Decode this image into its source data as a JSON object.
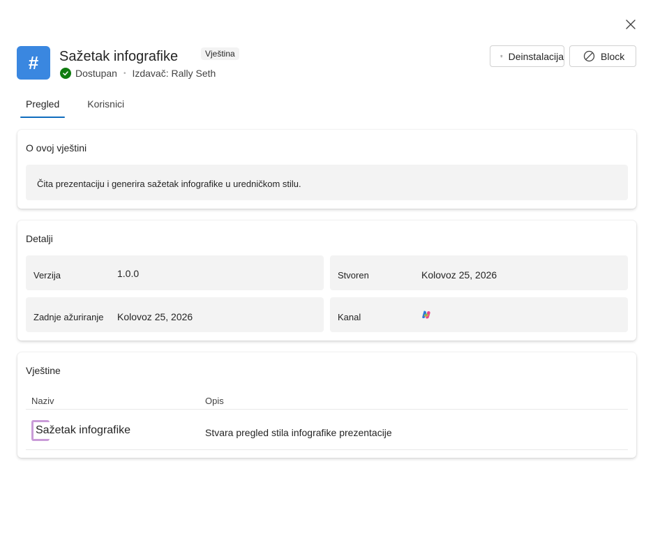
{
  "header": {
    "app_icon_glyph": "#",
    "title": "Sažetak infografike",
    "kind_badge": "Vještina",
    "status": "Dostupan",
    "publisher": "Izdavač: Rally Seth",
    "uninstall_label": "Deinstalacija",
    "block_label": "Block",
    "accent_color": "#3a87e0",
    "status_color": "#107c10"
  },
  "tabs": [
    {
      "label": "Pregled",
      "active": true
    },
    {
      "label": "Korisnici",
      "active": false
    }
  ],
  "about": {
    "title": "O ovoj vještini",
    "description": "Čita prezentaciju i generira sažetak infografike u uredničkom stilu."
  },
  "details": {
    "title": "Detalji",
    "fields": {
      "version_label": "Verzija",
      "version_value": "1.0.0",
      "created_label": "Stvoren",
      "created_value": "Kolovoz 25, 2026",
      "updated_label": "Zadnje ažuriranje",
      "updated_value": "Kolovoz 25, 2026",
      "channel_label": "Kanal",
      "channel_icon": "copilot-icon"
    }
  },
  "skills": {
    "title": "Vještine",
    "columns": [
      "Naziv",
      "Opis"
    ],
    "rows": [
      {
        "name": "Sažetak infografike",
        "description": "Stvara pregled stila infografike prezentacije"
      }
    ]
  }
}
